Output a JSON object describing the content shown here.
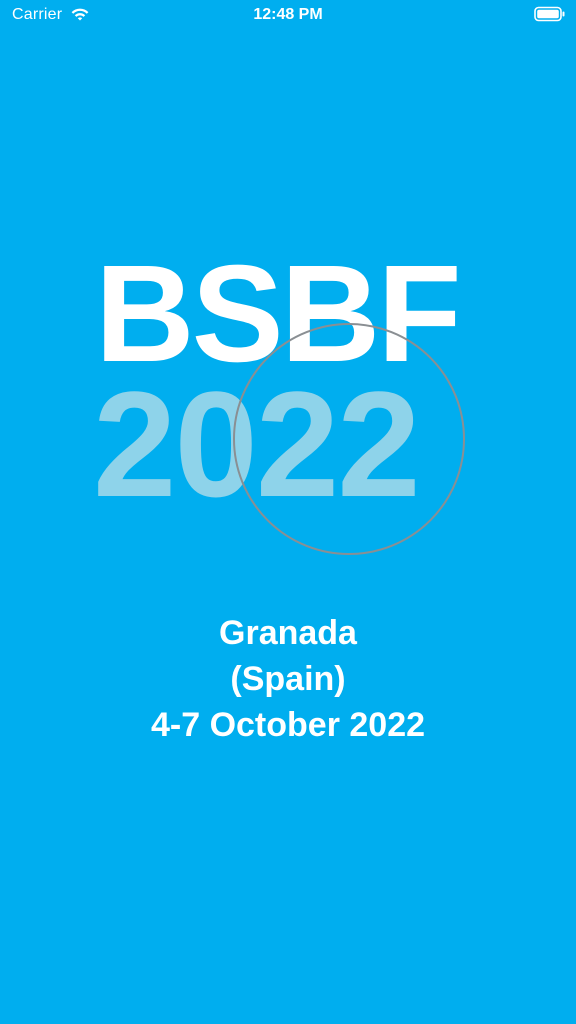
{
  "status_bar": {
    "carrier": "Carrier",
    "time": "12:48 PM",
    "wifi_icon": "wifi-icon",
    "battery_icon": "battery-icon"
  },
  "logo": {
    "title": "BSBF",
    "year": "2022"
  },
  "event": {
    "city": "Granada",
    "country": "(Spain)",
    "dates": "4-7 October 2022"
  },
  "colors": {
    "background": "#00AEEF",
    "text": "#FFFFFF",
    "year_text": "#8ED3EA",
    "lens_ring": "#8A8F93"
  }
}
